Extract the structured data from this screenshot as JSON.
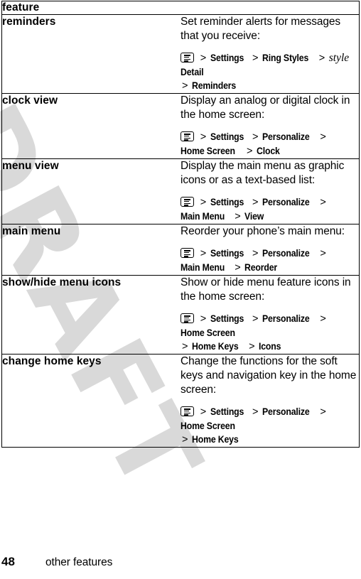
{
  "watermark": {
    "text": "DRAFT"
  },
  "table": {
    "header": {
      "term_label": "feature"
    },
    "menu_icon_name": "menu-key-icon",
    "rows": [
      {
        "term": "reminders",
        "description": "Set reminder alerts for messages that you receive:",
        "path_lines": [
          {
            "icon": true,
            "crumbs": [
              "Settings",
              "Ring Styles"
            ],
            "italic_crumb": "style",
            "trailing_crumb": "Detail"
          },
          {
            "icon": false,
            "crumbs": [
              "Reminders"
            ]
          }
        ],
        "path_plain": "Menu > Settings > Ring Styles > style Detail > Reminders"
      },
      {
        "term": "clock view",
        "description": "Display an analog or digital clock in the home screen:",
        "path_lines": [
          {
            "icon": true,
            "crumbs": [
              "Settings",
              "Personalize",
              "Home Screen",
              "Clock"
            ]
          }
        ],
        "path_plain": "Menu > Settings > Personalize > Home Screen > Clock"
      },
      {
        "term": "menu view",
        "description": "Display the main menu as graphic icons or as a text-based list:",
        "path_lines": [
          {
            "icon": true,
            "crumbs": [
              "Settings",
              "Personalize",
              "Main Menu",
              "View"
            ]
          }
        ],
        "path_plain": "Menu > Settings > Personalize > Main Menu > View"
      },
      {
        "term": "main menu",
        "description": "Reorder your phone’s main menu:",
        "path_lines": [
          {
            "icon": true,
            "crumbs": [
              "Settings",
              "Personalize",
              "Main Menu",
              "Reorder"
            ]
          }
        ],
        "path_plain": "Menu > Settings > Personalize > Main Menu > Reorder"
      },
      {
        "term": "show/hide menu icons",
        "description": "Show or hide menu feature icons in the home screen:",
        "path_lines": [
          {
            "icon": true,
            "crumbs": [
              "Settings",
              "Personalize",
              "Home Screen"
            ]
          },
          {
            "icon": false,
            "crumbs": [
              "Home Keys",
              "Icons"
            ]
          }
        ],
        "path_plain": "Menu > Settings > Personalize > Home Screen > Home Keys > Icons"
      },
      {
        "term": "change home keys",
        "description": "Change the functions for the soft keys and navigation key in the home screen:",
        "path_lines": [
          {
            "icon": true,
            "crumbs": [
              "Settings",
              "Personalize",
              "Home Screen"
            ]
          },
          {
            "icon": false,
            "crumbs": [
              "Home Keys"
            ]
          }
        ],
        "path_plain": "Menu > Settings > Personalize > Home Screen > Home Keys"
      }
    ]
  },
  "footer": {
    "page_number": "48",
    "section_title": "other features"
  }
}
